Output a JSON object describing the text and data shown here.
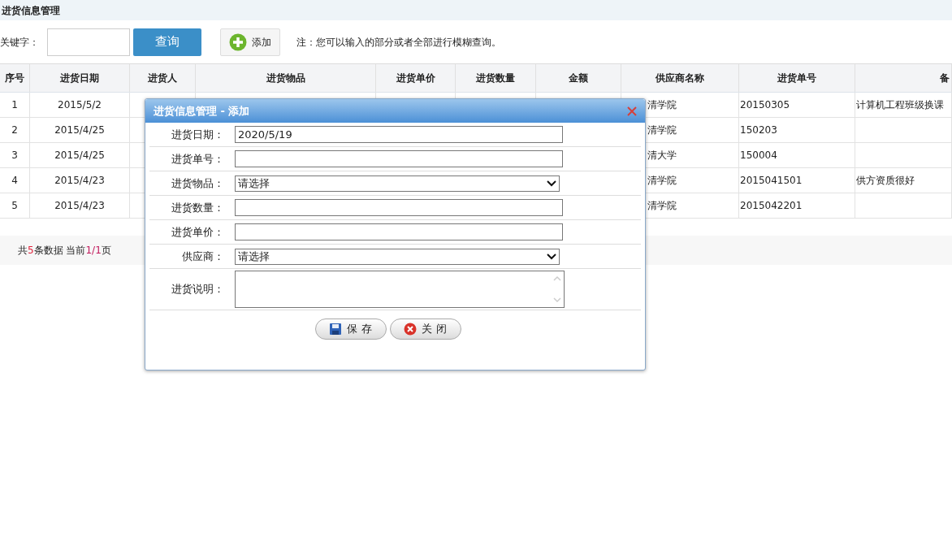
{
  "page_title": "进货信息管理",
  "toolbar": {
    "keyword_label": "关键字：",
    "search_button": "查询",
    "add_button": "添加",
    "note": "注：您可以输入的部分或者全部进行模糊查询。"
  },
  "table": {
    "columns": [
      "序号",
      "进货日期",
      "进货人",
      "进货物品",
      "进货单价",
      "进货数量",
      "金额",
      "供应商名称",
      "进货单号",
      "备"
    ],
    "rows": [
      {
        "index": "1",
        "date": "2015/5/2",
        "supplier": "清学院",
        "number": "20150305",
        "remark": "计算机工程班级换课"
      },
      {
        "index": "2",
        "date": "2015/4/25",
        "supplier": "清学院",
        "number": "150203"
      },
      {
        "index": "3",
        "date": "2015/4/25",
        "supplier": "清大学",
        "number": "150004"
      },
      {
        "index": "4",
        "date": "2015/4/23",
        "supplier": "清学院",
        "number": "2015041501",
        "remark": "供方资质很好"
      },
      {
        "index": "5",
        "date": "2015/4/23",
        "supplier": "清学院",
        "number": "2015042201"
      }
    ]
  },
  "footer": {
    "prefix": "共",
    "count": "5",
    "middle": "条数据 当前",
    "page": "1/1",
    "suffix": "页"
  },
  "dialog": {
    "title": "进货信息管理 - 添加",
    "fields": [
      {
        "kind": "text",
        "label": "进货日期：",
        "value": "2020/5/19"
      },
      {
        "kind": "text",
        "label": "进货单号："
      },
      {
        "kind": "select",
        "label": "进货物品：",
        "value": "请选择"
      },
      {
        "kind": "text",
        "label": "进货数量："
      },
      {
        "kind": "text",
        "label": "进货单价："
      },
      {
        "kind": "select",
        "label": "供应商：",
        "value": "请选择"
      },
      {
        "kind": "textarea",
        "label": "进货说明："
      }
    ],
    "buttons": [
      {
        "kind": "save",
        "label": "保 存"
      },
      {
        "kind": "close",
        "label": "关 闭"
      }
    ]
  }
}
